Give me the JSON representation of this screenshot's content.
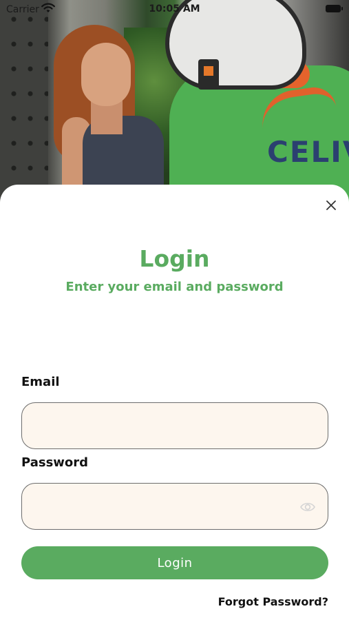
{
  "status_bar": {
    "carrier": "Carrier",
    "time": "10:05 AM"
  },
  "hero": {
    "logo_text": "CELIV"
  },
  "login": {
    "title": "Login",
    "subtitle": "Enter your email and password",
    "email_label": "Email",
    "email_value": "",
    "password_label": "Password",
    "password_value": "",
    "button_label": "Login",
    "forgot_label": "Forgot Password?"
  },
  "colors": {
    "accent": "#5aab60",
    "field_bg": "#fdf6ee",
    "field_border": "#6c6c6c"
  },
  "icons": {
    "close": "close-icon",
    "eye": "eye-icon",
    "wifi": "wifi-icon",
    "battery": "battery-icon"
  }
}
